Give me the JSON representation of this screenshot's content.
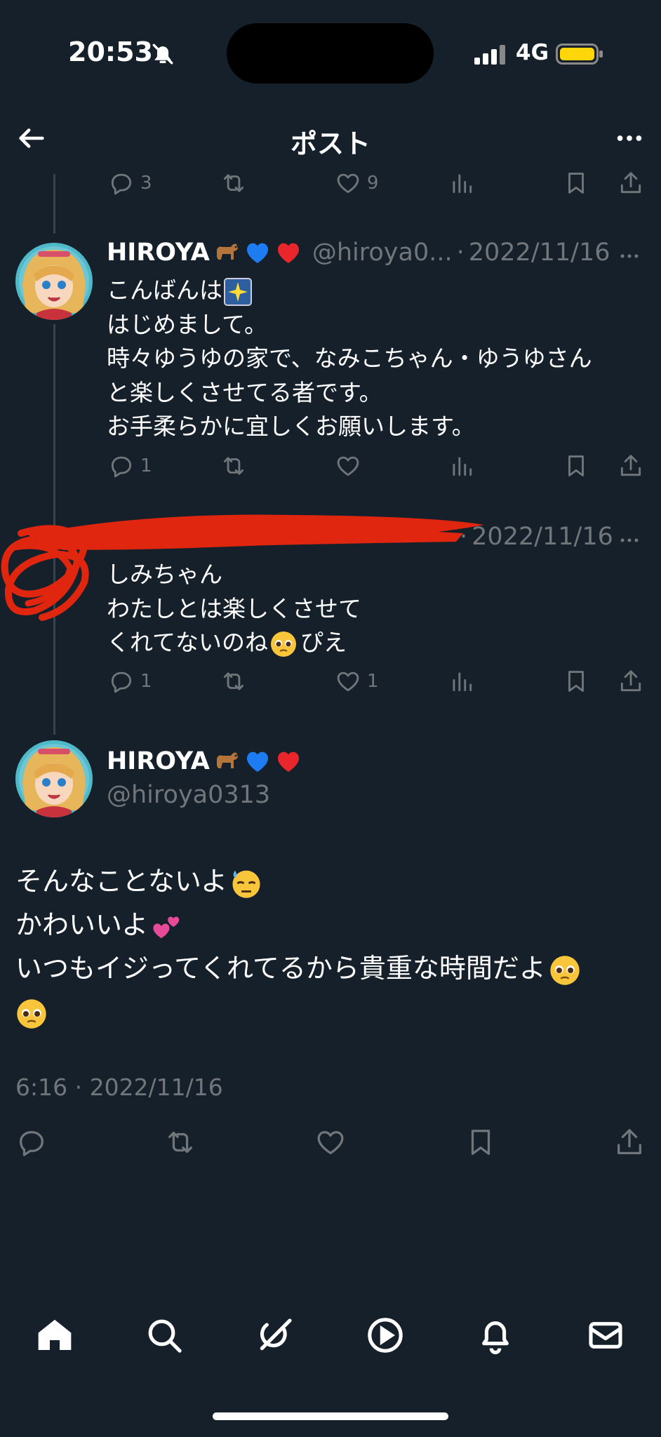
{
  "status_bar": {
    "time": "20:53",
    "network": "4G"
  },
  "header": {
    "title": "ポスト"
  },
  "top_actions": {
    "replies": "3",
    "likes": "9"
  },
  "reply1": {
    "name": "HIROYA",
    "handle": "@hiroya0...",
    "date": "2022/11/16",
    "lines": [
      "こんばんは",
      "はじめまして。",
      "時々ゆうゆの家で、なみこちゃん・ゆうゆさん",
      "と楽しくさせてる者です。",
      "お手柔らかに宜しくお願いします。"
    ],
    "replies": "1"
  },
  "reply2": {
    "date": "2022/11/16",
    "lines": [
      "しみちゃん",
      "わたしとは楽しくさせて",
      "くれてないのね",
      "ぴえ"
    ],
    "replies": "1",
    "likes": "1"
  },
  "main": {
    "name": "HIROYA",
    "handle": "@hiroya0313",
    "lines": [
      "そんなことないよ",
      "かわいいよ",
      "いつもイジってくれてるから貴重な時間だよ"
    ],
    "timestamp": "6:16 · 2022/11/16"
  },
  "colors": {
    "bg": "#15202b",
    "muted": "#71767b",
    "thread": "#38444d",
    "redact": "#e0260f"
  },
  "icons": [
    "back-arrow-icon",
    "more-icon",
    "reply-icon",
    "retweet-icon",
    "like-icon",
    "views-icon",
    "bookmark-icon",
    "share-icon",
    "home-icon",
    "search-icon",
    "grok-icon",
    "video-icon",
    "notifications-icon",
    "messages-icon"
  ]
}
